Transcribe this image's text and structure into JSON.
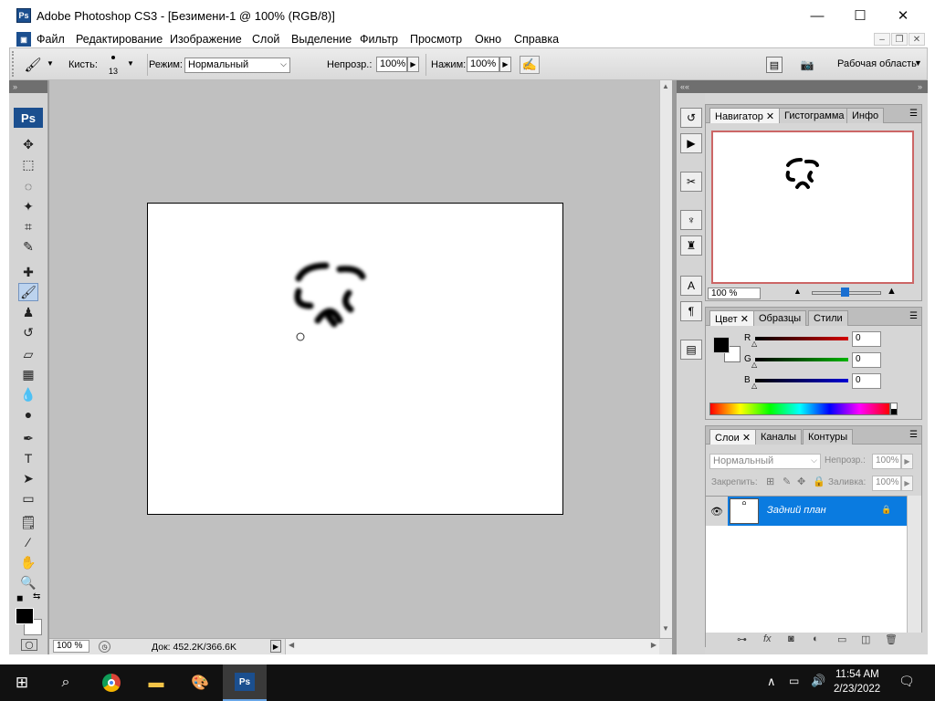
{
  "window": {
    "title": "Adobe Photoshop CS3 - [Безимени-1 @ 100% (RGB/8)]",
    "app_logo": "Ps",
    "minimize": "—",
    "maximize": "☐",
    "close": "✕"
  },
  "menu": {
    "items": [
      "Файл",
      "Редактирование",
      "Изображение",
      "Слой",
      "Выделение",
      "Фильтр",
      "Просмотр",
      "Окно",
      "Справка"
    ]
  },
  "options": {
    "brush_label": "Кисть:",
    "brush_size": "13",
    "mode_label": "Режим:",
    "mode_value": "Нормальный",
    "opacity_label": "Непрозр.:",
    "opacity_value": "100%",
    "flow_label": "Нажим:",
    "flow_value": "100%",
    "workspace_label": "Рабочая область"
  },
  "toolbox": {
    "logo": "Ps",
    "tools": [
      {
        "name": "move-tool-icon",
        "glyph": "✥"
      },
      {
        "name": "marquee-tool-icon",
        "glyph": "⬚"
      },
      {
        "name": "lasso-tool-icon",
        "glyph": "◌"
      },
      {
        "name": "magic-wand-tool-icon",
        "glyph": "✦"
      },
      {
        "name": "crop-tool-icon",
        "glyph": "⌗"
      },
      {
        "name": "slice-tool-icon",
        "glyph": "✎"
      },
      {
        "name": "healing-brush-tool-icon",
        "glyph": "✚"
      },
      {
        "name": "brush-tool-icon",
        "glyph": "🖌"
      },
      {
        "name": "clone-stamp-tool-icon",
        "glyph": "♟"
      },
      {
        "name": "history-brush-tool-icon",
        "glyph": "↺"
      },
      {
        "name": "eraser-tool-icon",
        "glyph": "▱"
      },
      {
        "name": "gradient-tool-icon",
        "glyph": "▦"
      },
      {
        "name": "blur-tool-icon",
        "glyph": "💧"
      },
      {
        "name": "dodge-tool-icon",
        "glyph": "●"
      },
      {
        "name": "pen-tool-icon",
        "glyph": "✒"
      },
      {
        "name": "type-tool-icon",
        "glyph": "T"
      },
      {
        "name": "path-selection-tool-icon",
        "glyph": "➤"
      },
      {
        "name": "shape-tool-icon",
        "glyph": "▭"
      },
      {
        "name": "notes-tool-icon",
        "glyph": "🗒"
      },
      {
        "name": "eyedropper-tool-icon",
        "glyph": "⁄"
      },
      {
        "name": "hand-tool-icon",
        "glyph": "✋"
      },
      {
        "name": "zoom-tool-icon",
        "glyph": "🔍"
      }
    ]
  },
  "status": {
    "zoom": "100 %",
    "doc": "Док: 452.2K/366.6K"
  },
  "navigator_panel": {
    "tabs": [
      "Навигатор",
      "Гистограмма",
      "Инфо"
    ],
    "zoom": "100 %"
  },
  "color_panel": {
    "tabs": [
      "Цвет",
      "Образцы",
      "Стили"
    ],
    "channels": [
      {
        "label": "R",
        "value": "0",
        "color": "#d40000"
      },
      {
        "label": "G",
        "value": "0",
        "color": "#00b400"
      },
      {
        "label": "B",
        "value": "0",
        "color": "#0000d4"
      }
    ]
  },
  "layers_panel": {
    "tabs": [
      "Слои",
      "Каналы",
      "Контуры"
    ],
    "blend_mode": "Нормальный",
    "opacity_label": "Непрозр.:",
    "opacity_value": "100%",
    "lock_label": "Закрепить:",
    "fill_label": "Заливка:",
    "fill_value": "100%",
    "layer_name": "Задний план"
  },
  "taskbar": {
    "time": "11:54 AM",
    "date": "2/23/2022",
    "ps_label": "Ps"
  },
  "colors": {
    "accent": "#0a7be0",
    "ps_blue": "#1b4f8f"
  }
}
